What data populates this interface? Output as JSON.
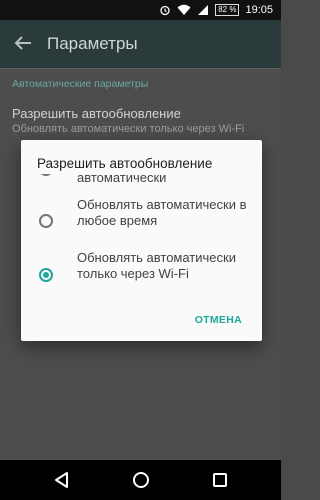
{
  "status_bar": {
    "battery": "82 %",
    "time": "19:05"
  },
  "toolbar": {
    "title": "Параметры"
  },
  "settings": {
    "section_header": "Автоматические параметры",
    "pref_title": "Разрешить автообновление",
    "pref_summary": "Обновлять автоматически только через Wi-Fi"
  },
  "dialog": {
    "title": "Разрешить автообновление",
    "options": [
      {
        "label": "автоматически",
        "checked": false
      },
      {
        "label": "Обновлять автоматически в любое время",
        "checked": false
      },
      {
        "label": "Обновлять автоматически только через Wi-Fi",
        "checked": true
      }
    ],
    "cancel_label": "ОТМЕНА"
  },
  "colors": {
    "accent": "#20a69a",
    "toolbar": "#2b3a3a",
    "section_header": "#68a8a0"
  }
}
